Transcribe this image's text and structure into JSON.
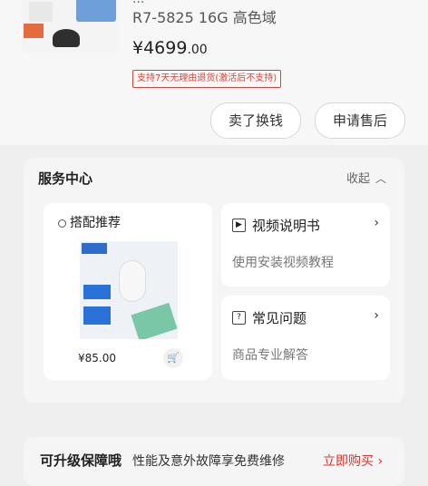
{
  "product": {
    "spec_cut": "...",
    "spec_line": "R7-5825 16G 高色域",
    "price_main": "¥4699",
    "price_decimal": ".00",
    "return_tag": "支持7天无理由退货(激活后不支持)"
  },
  "actions": {
    "sell_label": "卖了换钱",
    "apply_label": "申请售后"
  },
  "service": {
    "title": "服务中心",
    "collapse_label": "收起",
    "combo": {
      "title": "搭配推荐",
      "price": "¥85.00"
    },
    "guide": {
      "title": "视频说明书",
      "subtitle": "使用安装视频教程"
    },
    "faq": {
      "title": "常见问题",
      "subtitle": "商品专业解答"
    }
  },
  "upgrade": {
    "label": "可升级保障哦",
    "desc": "性能及意外故障享免费维修",
    "buy_label": "立即购买 ›"
  },
  "icons": {
    "collapse": "chevron-up-icon",
    "guide": "video-book-icon",
    "faq": "question-icon",
    "arrow": "chevron-right-icon",
    "cart": "cart-icon"
  }
}
